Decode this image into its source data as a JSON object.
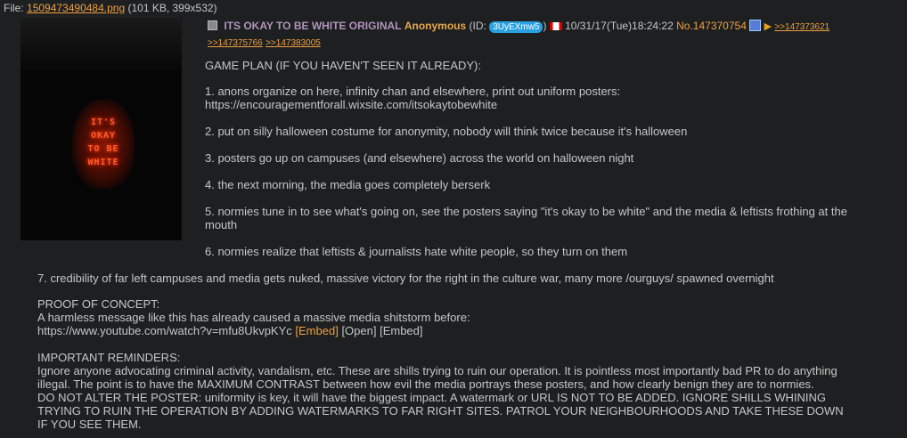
{
  "file": {
    "prefix": "File: ",
    "name": "1509473490484.png",
    "info": " (101 KB, 399x532)"
  },
  "thumbnail": {
    "text_lines": [
      "IT'S",
      "OKAY",
      "TO BE",
      "WHITE"
    ]
  },
  "post": {
    "subject": "ITS OKAY TO BE WHITE ORIGINAL",
    "name": "Anonymous",
    "id_prefix": "(ID: ",
    "id": "3UyEXmw5",
    "id_suffix": ")",
    "datetime": "10/31/17(Tue)18:24:22",
    "number": "No.147370754",
    "backlinks": [
      ">>147373621",
      ">>147375766",
      ">>147383005"
    ],
    "colors": {
      "subject": "#b294bb",
      "name": "#e9a84a",
      "link": "#f0a040",
      "id_badge": "#2aa0e0"
    }
  },
  "body": {
    "game_plan_title": "GAME PLAN (IF YOU HAVEN'T SEEN IT ALREADY):",
    "step1_a": "1. anons organize on here, infinity chan and elsewhere, print out uniform posters:",
    "step1_b": "https://encouragementforall.wixsite.com/itsokaytobewhite",
    "step2": "2. put on silly halloween costume for anonymity, nobody will think twice because it's halloween",
    "step3": "3. posters go up on campuses (and elsewhere) across the world on halloween night",
    "step4": "4. the next morning, the media goes completely berserk",
    "step5_a": "5. normies tune in to see what's going on, see the posters saying \"it's okay to be white\" and the media & leftists frothing at the",
    "step5_b": "mouth",
    "step6": "6. normies realize that leftists & journalists hate white people, so they turn on them",
    "step7": "7. credibility of far left campuses and media gets nuked, massive victory for the right in the culture war, many more /ourguys/ spawned overnight",
    "proof_title": "PROOF OF CONCEPT:",
    "proof_line": "A harmless message like this has already caused a massive media shitstorm before:",
    "proof_url": "https://www.youtube.com/watch?v=mfu8UkvpKYc",
    "embed1": "[Embed]",
    "open": "[Open]",
    "embed2": "[Embed]",
    "reminders_title": "IMPORTANT REMINDERS:",
    "rem1_a": "Ignore anyone advocating criminal activity, vandalism, etc. These are shills trying to ruin our operation. It is pointless most importantly bad PR to do anything",
    "rem1_b": "illegal. The point is to have the MAXIMUM CONTRAST between how evil the media portrays these posters, and how clearly benign they are to normies.",
    "rem2_a": "DO NOT ALTER THE POSTER: uniformity is key, it will have the biggest impact. A watermark or URL IS NOT TO BE ADDED. IGNORE SHILLS WHINING",
    "rem2_b": "TRYING TO RUIN THE OPERATION BY ADDING WATERMARKS TO FAR RIGHT SITES. PATROL YOUR NEIGHBOURHOODS AND TAKE THESE DOWN",
    "rem2_c": "IF YOU SEE THEM."
  }
}
